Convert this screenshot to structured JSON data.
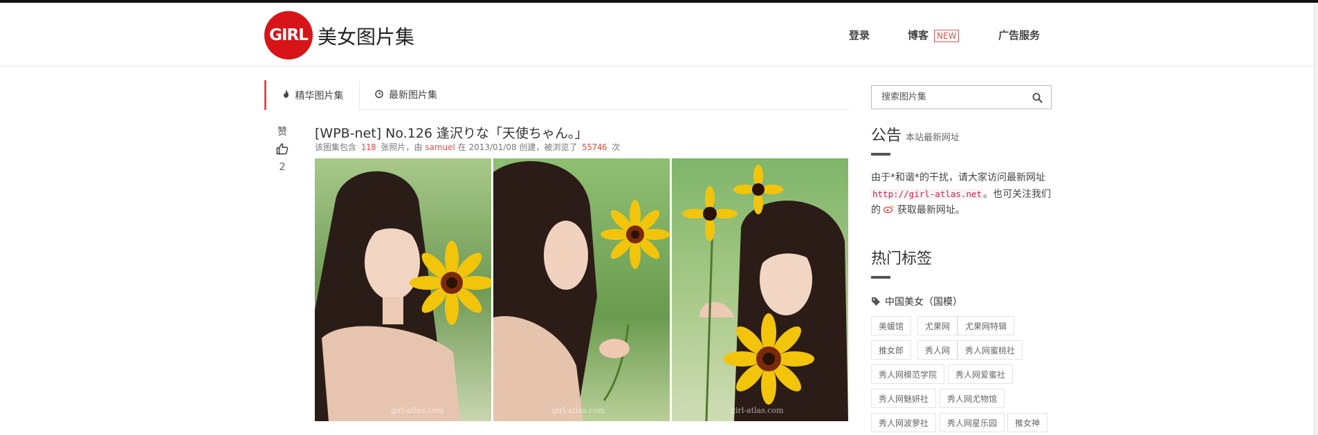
{
  "header": {
    "logo_badge": "GIRL",
    "site_name": "美女图片集",
    "nav": {
      "login": "登录",
      "blog": "博客",
      "blog_badge": "NEW",
      "ads": "广告服务"
    }
  },
  "tabs": [
    {
      "label": "精华图片集",
      "icon": "fire-icon",
      "active": true
    },
    {
      "label": "最新图片集",
      "icon": "clock-icon",
      "active": false
    }
  ],
  "post": {
    "vote_label": "赞",
    "vote_count": "2",
    "title": "[WPB-net] No.126 逢沢りな「天使ちゃん。」",
    "meta": {
      "prefix": "该图集包含",
      "photo_count": "118",
      "photos_suffix": "张照片，由",
      "author": "samuel",
      "created_prefix": "在 2013/01/08 创建，被浏览了",
      "views": "55746",
      "views_suffix": "次"
    },
    "watermark": "girl-atlas.com"
  },
  "sidebar": {
    "search_placeholder": "搜索图片集",
    "notice_title": "公告",
    "notice_subtitle": "本站最新网址",
    "notice": {
      "text1": "由于*和谐*的干扰，请大家访问最新网址",
      "url": "http://girl-atlas.net",
      "text2": "。也可关注我们的",
      "text3": "获取最新网址。"
    },
    "tags_title": "热门标签",
    "tag_category": "中国美女（国模）",
    "tags": [
      "美媛馆",
      "尤果网",
      "尤果网特辑",
      "推女郎",
      "秀人网",
      "秀人网蜜桃社",
      "秀人网模范学院",
      "秀人网爱蜜社",
      "秀人网魅妍社",
      "秀人网尤物馆",
      "秀人网波萝社",
      "秀人网星乐园",
      "推女神"
    ]
  },
  "colors": {
    "accent": "#d9534f",
    "logo_red": "#d71518",
    "topbar": "#111111"
  }
}
